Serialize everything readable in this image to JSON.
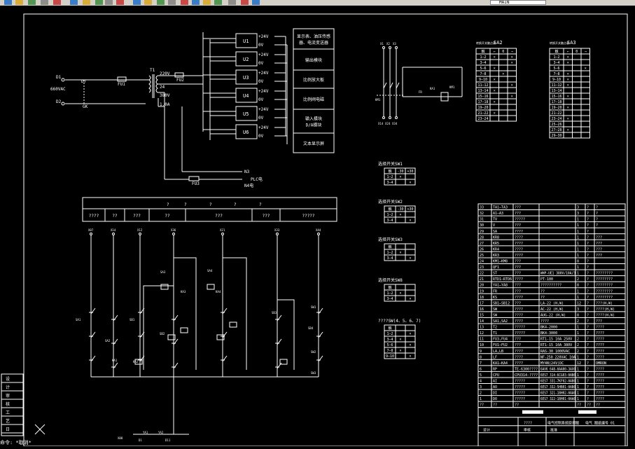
{
  "toolbar": {
    "layer_name": "MAIN",
    "icons": [
      "new-icon",
      "open-icon",
      "save-icon",
      "print-icon",
      "cut-icon",
      "copy-icon",
      "paste-icon",
      "match-icon",
      "undo-icon",
      "redo-icon",
      "pan-icon",
      "zoom-realtime-icon",
      "zoom-window-icon",
      "zoom-previous-icon",
      "properties-icon",
      "design-center-icon",
      "tool-palette-icon",
      "calc-icon",
      "help-icon",
      "layer-icon",
      "layer-state-icon"
    ]
  },
  "power": {
    "d1": "D1",
    "d2": "D2",
    "voltage": "660VAC",
    "fu1": "FU1",
    "fu2": "FU2",
    "fu3": "FU3",
    "t1": "T1",
    "v220": "220V",
    "v24": "24",
    "v380": "380V",
    "a10": "1.0A",
    "gk": "GK",
    "d7": "D7",
    "n3": "N3",
    "plc": "PLC电",
    "n4": "N4电"
  },
  "psu": {
    "units": [
      {
        "name": "U1",
        "out": "+24V",
        "zero": "0V"
      },
      {
        "name": "U2",
        "out": "+24V",
        "zero": "0V"
      },
      {
        "name": "U3",
        "out": "+24V",
        "zero": "0V"
      },
      {
        "name": "U4",
        "out": "+24V",
        "zero": "0V"
      },
      {
        "name": "U5",
        "out": "+24V",
        "zero": "0V"
      },
      {
        "name": "U6",
        "out": "+24V",
        "zero": "0V"
      }
    ],
    "loads": [
      "显示表、油压传感器、电流变送器",
      "输出模块",
      "比例放大板",
      "比例阀电磁",
      "输入模块 D/A模块",
      "文本显示屏"
    ]
  },
  "header_strip": {
    "top": [
      "?",
      "?",
      "?",
      "?",
      "?"
    ],
    "cells": [
      "????",
      "??",
      "???",
      "??",
      "???",
      "???",
      "?????"
    ]
  },
  "sa2": {
    "title": "SA2",
    "small": "转换开关触点表",
    "rows": [
      [
        "触",
        "←",
        "0",
        "→"
      ],
      [
        "1—2",
        "×",
        "",
        "×"
      ],
      [
        "3—4",
        "",
        "",
        "×"
      ],
      [
        "5—6",
        "×",
        "",
        ""
      ],
      [
        "7—8",
        "",
        "×",
        ""
      ],
      [
        "9—10",
        "×",
        "",
        ""
      ],
      [
        "11—12",
        "",
        "",
        "×"
      ],
      [
        "13—14",
        "×",
        "",
        ""
      ],
      [
        "15—16",
        "",
        "",
        "×"
      ],
      [
        "17—18",
        "×",
        "",
        ""
      ],
      [
        "19—20",
        "",
        "",
        ""
      ],
      [
        "21—22",
        "×",
        "",
        ""
      ],
      [
        "23—24",
        "",
        "",
        ""
      ]
    ]
  },
  "sa3": {
    "title": "SA3",
    "small": "转换开关触点表",
    "rows": [
      [
        "触",
        "←",
        "0",
        "→"
      ],
      [
        "1—2",
        "×",
        "",
        ""
      ],
      [
        "3—4",
        "×",
        "",
        ""
      ],
      [
        "5—6",
        "",
        "",
        "×"
      ],
      [
        "7—8",
        "×",
        "",
        ""
      ],
      [
        "9—10",
        "×",
        "",
        ""
      ],
      [
        "11—12",
        "×",
        "",
        ""
      ],
      [
        "13—14",
        "",
        "",
        ""
      ],
      [
        "15—16",
        "×",
        "",
        ""
      ],
      [
        "17—18",
        "",
        "",
        ""
      ],
      [
        "19—20",
        "×",
        "",
        ""
      ],
      [
        "21—22",
        "",
        "",
        ""
      ],
      [
        "23—24",
        "×",
        "",
        ""
      ],
      [
        "25—26",
        "",
        "",
        ""
      ],
      [
        "27—28",
        "×",
        "",
        ""
      ],
      [
        "29—30",
        "",
        "",
        ""
      ]
    ]
  },
  "sw_tables": [
    {
      "title": "SW1",
      "caption": "选择开关",
      "rows": [
        [
          "触",
          "-30",
          "+30"
        ],
        [
          "1—2",
          "×",
          ""
        ],
        [
          "3—4",
          "",
          "×"
        ]
      ]
    },
    {
      "title": "SW2",
      "caption": "选择开关",
      "rows": [
        [
          "触",
          "-30",
          "+30"
        ],
        [
          "1—2",
          "×",
          ""
        ],
        [
          "3—4",
          "",
          "×"
        ]
      ]
    },
    {
      "title": "SW3",
      "caption": "选择开关",
      "rows": [
        [
          "触",
          "",
          ""
        ],
        [
          "1—2",
          "×",
          ""
        ],
        [
          "3—4",
          "",
          "×"
        ]
      ]
    },
    {
      "title": "SW8",
      "caption": "选择开关",
      "rows": [
        [
          "触",
          "",
          ""
        ],
        [
          "1—2",
          "×",
          ""
        ],
        [
          "3—4",
          "",
          "×"
        ]
      ]
    },
    {
      "title": "????SW(4、5、6、7)",
      "caption": "",
      "rows": [
        [
          "触",
          "",
          ""
        ],
        [
          "1—2",
          "",
          "×"
        ],
        [
          "3—4",
          "×",
          ""
        ],
        [
          "5—6",
          "",
          "×"
        ],
        [
          "7—8",
          "×",
          ""
        ],
        [
          "9—10",
          "",
          "×"
        ]
      ]
    }
  ],
  "parts": [
    [
      "33",
      "TA1—TA3",
      "???",
      "",
      "3",
      "?",
      "?"
    ],
    [
      "32",
      "A1—A3",
      "???",
      "",
      "3",
      "?",
      "?"
    ],
    [
      "31",
      "TV",
      "?????",
      "",
      "1",
      "?",
      "?"
    ],
    [
      "30",
      "V",
      "???",
      "",
      "1",
      "?",
      "?"
    ],
    [
      "29",
      "SA",
      "????",
      "",
      "1",
      "?",
      ""
    ],
    [
      "28",
      "KR8",
      "????",
      "",
      "1",
      "?",
      "???"
    ],
    [
      "27",
      "KR5",
      "????",
      "",
      "1",
      "?",
      "???"
    ],
    [
      "26",
      "KR4",
      "????",
      "",
      "1",
      "?",
      "???"
    ],
    [
      "25",
      "KR3",
      "????",
      "",
      "1",
      "?",
      "???"
    ],
    [
      "24",
      "KM1—KM8",
      "???",
      "",
      "8",
      "?",
      ""
    ],
    [
      "23",
      "QF1",
      "???",
      "",
      "1",
      "?",
      ""
    ],
    [
      "22",
      "ST",
      "???",
      "WHP-UE1 380V/10A/3",
      "1",
      "?",
      "????????"
    ],
    [
      "21",
      "RTD1—RTD6",
      "????",
      "PT-100",
      "2",
      "?",
      "????????"
    ],
    [
      "20",
      "YA1—YA8",
      "???",
      "??????????",
      "8",
      "?",
      "????????"
    ],
    [
      "19",
      "FR",
      "???",
      "??",
      "1",
      "?",
      "????????"
    ],
    [
      "18",
      "KS",
      "????",
      "??",
      "1",
      "?",
      "????????"
    ],
    [
      "17",
      "SB1—SB12",
      "???",
      "LA-22 (H,W)",
      "12",
      "?",
      "???(H,W)"
    ],
    [
      "16",
      "SW",
      "????",
      "AC-22 (H,W)",
      "3",
      "?",
      "????(H,W)"
    ],
    [
      "15",
      "SW",
      "????",
      "AUG-22 (H,W)",
      "8",
      "?",
      "????(H,W)"
    ],
    [
      "14",
      "SA1,SA2",
      "????",
      "????",
      "2",
      "?",
      "???"
    ],
    [
      "13",
      "T2",
      "?????",
      "BK4-2000",
      "1",
      "?",
      "????"
    ],
    [
      "12",
      "T1",
      "?????",
      "BK4-3000",
      "1",
      "?",
      "????"
    ],
    [
      "11",
      "FU3,FU4",
      "???",
      "RT1-15 10A 250V",
      "2",
      "?",
      "????"
    ],
    [
      "10",
      "FU1—FU2",
      "???",
      "RT1-15 10A 380V",
      "2",
      "?",
      "????"
    ],
    [
      "9",
      "LA,LB",
      "????",
      "RAS-30 1000VAC",
      "2",
      "?",
      "????"
    ],
    [
      "8",
      "LF",
      "????",
      "NF-250 220VAC 10A",
      "1",
      "?",
      "????"
    ],
    [
      "7",
      "KA1—KA4",
      "????",
      "MY4N(24V)DC",
      "12",
      "?",
      "OMRON"
    ],
    [
      "6",
      "RP",
      "TE-6300????",
      "6AV6 648-0AA00-3AX0",
      "1",
      "?",
      "????"
    ],
    [
      "5",
      "CPU",
      "CPU314-????",
      "6ES7 314-6CG03-0AB0",
      "1",
      "?",
      "????"
    ],
    [
      "4",
      "AI",
      "?????",
      "6ES7 331-7KF02-0AB0",
      "1",
      "?",
      "????"
    ],
    [
      "3",
      "AO",
      "?????",
      "6ES7 332-5HB01-0AB0",
      "1",
      "?",
      "????"
    ],
    [
      "2",
      "DI",
      "?????",
      "6ES7 321-1BH02-0AA0",
      "1",
      "?",
      "????"
    ],
    [
      "1",
      "DO",
      "?????",
      "6ES7 322-1BH01-0AA0",
      "1",
      "?",
      "????"
    ],
    [
      "??",
      "??",
      "??",
      "",
      "??",
      "??",
      "??"
    ]
  ],
  "title_block": {
    "project": "????",
    "desc": "电气控制系统原理图",
    "drawing_no": "电气 图纸编号 01",
    "designer": "设计",
    "checker": "审核",
    "approve": "批准"
  },
  "ladder": {
    "buses": [
      "X07",
      "X14",
      "X12",
      "X36",
      "X21",
      "X33",
      "X44"
    ],
    "labels": [
      "SA1",
      "SA2",
      "SB1",
      "SB2",
      "KA1",
      "KA2",
      "KA3",
      "KA4",
      "SA3",
      "SA4",
      "SB3",
      "SB4",
      "SW1",
      "SW2",
      "SW3",
      "YA1",
      "YA2",
      "D1",
      "D11",
      "X08"
    ]
  },
  "motor": {
    "labels": [
      "X1",
      "X2",
      "X3",
      "KM1",
      "FR",
      "KA1",
      "KM1",
      "X14",
      "X24",
      "X34"
    ]
  },
  "left_panel": [
    "设",
    "计",
    "审",
    "核",
    "工",
    "艺",
    "日"
  ],
  "cmdline": "命令: *取消*"
}
